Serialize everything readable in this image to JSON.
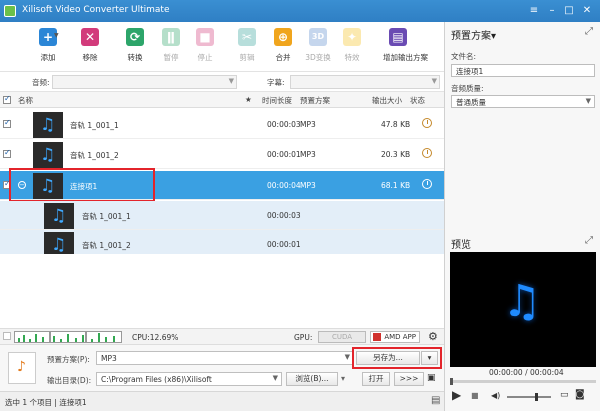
{
  "window": {
    "title": "Xilisoft Video Converter Ultimate"
  },
  "toolbar": {
    "add": "添加",
    "remove": "移除",
    "convert": "转换",
    "pause": "暂停",
    "stop": "停止",
    "clip": "剪辑",
    "merge": "合并",
    "threed": "3D变换",
    "effect": "特效",
    "add_profile": "增加输出方案"
  },
  "filters": {
    "audio_label": "音频:",
    "subtitle_label": "字幕:"
  },
  "columns": {
    "name": "名称",
    "star": "★",
    "duration": "时间长度",
    "profile": "预置方案",
    "output_size": "输出大小",
    "status": "状态"
  },
  "rows": [
    {
      "name": "音轨 1_001_1",
      "duration": "00:00:03",
      "format": "MP3",
      "size": "47.8 KB"
    },
    {
      "name": "音轨 1_001_2",
      "duration": "00:00:01",
      "format": "MP3",
      "size": "20.3 KB"
    },
    {
      "name": "连接项1",
      "duration": "00:00:04",
      "format": "MP3",
      "size": "68.1 KB"
    },
    {
      "name": "音轨 1_001_1",
      "duration": "00:00:03"
    },
    {
      "name": "音轨 1_001_2",
      "duration": "00:00:01"
    }
  ],
  "statusline": {
    "cpu": "CPU:12.69%",
    "gpu": "GPU:",
    "cuda": "CUDA",
    "amd": "AMD APP"
  },
  "bottom": {
    "profile_label": "预置方案(P):",
    "profile_value": "MP3",
    "save_as": "另存为...",
    "output_label": "输出目录(D):",
    "output_value": "C:\\Program Files (x86)\\Xilisoft",
    "browse": "浏览(B)...",
    "open": "打开",
    "more": ">>>"
  },
  "statusbar": {
    "text": "选中 1 个项目 | 连接项1"
  },
  "right": {
    "profile_title": "预置方案▾",
    "filename_label": "文件名:",
    "filename_value": "连接项1",
    "quality_label": "音频质量:",
    "quality_value": "普通质量",
    "preview_title": "预览",
    "time": "00:00:00 / 00:00:04"
  },
  "colors": {
    "accent": "#3aa0e2",
    "titlebar": "#2f7fc4",
    "highlight": "#e3242b"
  },
  "icons": [
    "add-icon",
    "remove-icon",
    "convert-icon",
    "pause-icon",
    "stop-icon",
    "clip-icon",
    "merge-icon",
    "3d-icon",
    "effect-icon",
    "add-profile-icon",
    "music-note-icon",
    "clock-icon",
    "gear-icon",
    "play-icon",
    "stop-icon",
    "volume-icon",
    "camera-icon",
    "folder-icon",
    "expand-icon"
  ]
}
